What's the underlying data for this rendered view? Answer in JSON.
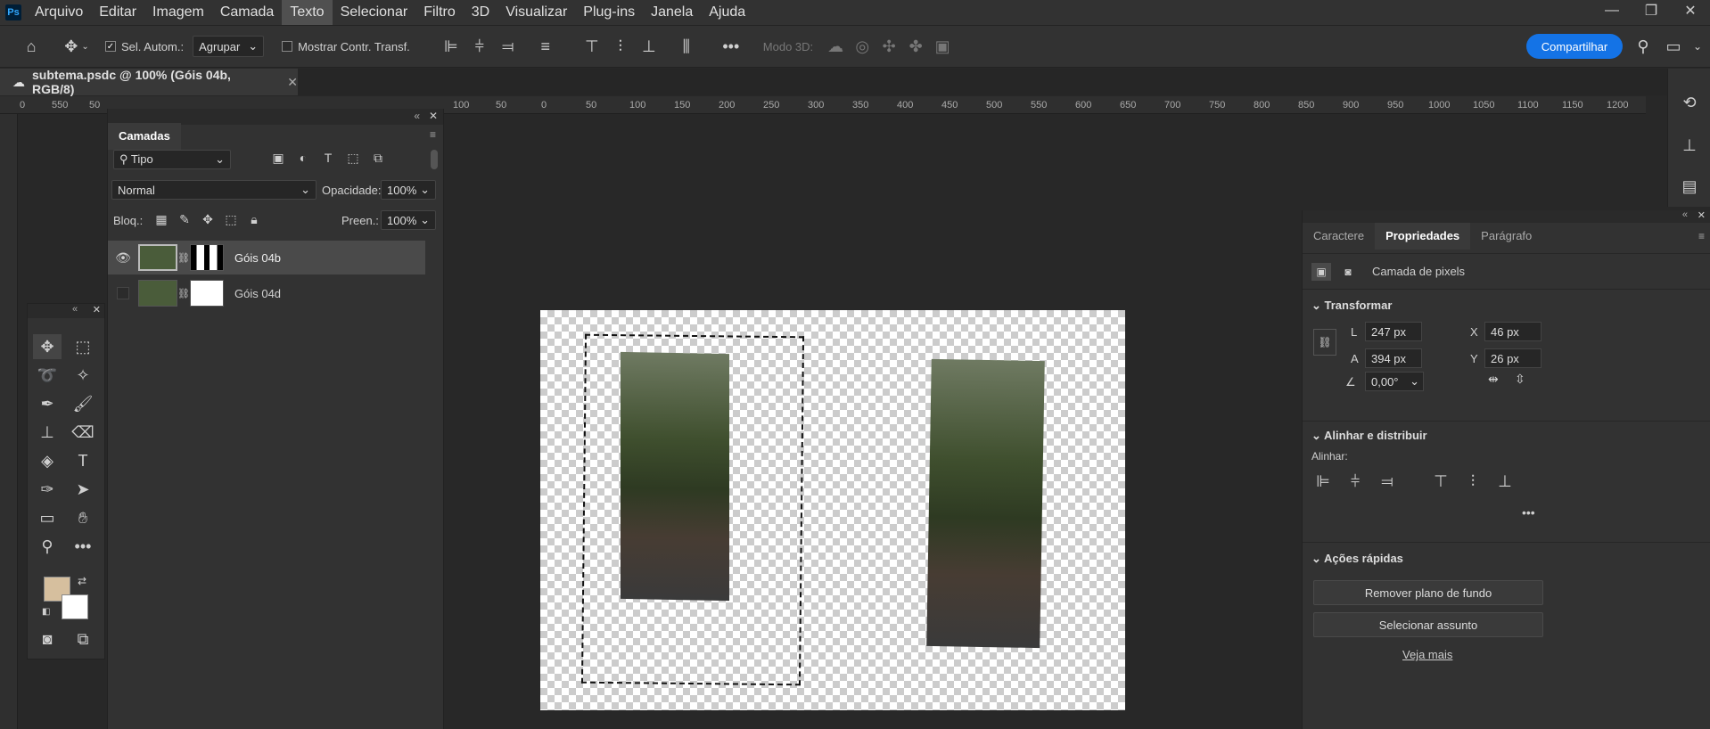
{
  "app": {
    "logo": "Ps"
  },
  "menu": [
    "Arquivo",
    "Editar",
    "Imagem",
    "Camada",
    "Texto",
    "Selecionar",
    "Filtro",
    "3D",
    "Visualizar",
    "Plug-ins",
    "Janela",
    "Ajuda"
  ],
  "options": {
    "auto_select_label": "Sel. Autom.:",
    "group_value": "Agrupar",
    "show_transform_label": "Mostrar Contr. Transf.",
    "mode_3d_label": "Modo 3D:",
    "share_label": "Compartilhar"
  },
  "document": {
    "tab_title": "subtema.psdc @ 100% (Góis 04b, RGB/8)"
  },
  "ruler": {
    "h_ticks": [
      "0",
      "550",
      "50",
      "100",
      "50",
      "0",
      "50",
      "100",
      "150",
      "200",
      "250",
      "300",
      "350",
      "400",
      "450",
      "500",
      "550",
      "600",
      "650",
      "700",
      "750",
      "800",
      "850",
      "900",
      "950",
      "1000",
      "1050",
      "1100",
      "1150",
      "1200"
    ]
  },
  "layers_panel": {
    "tab": "Camadas",
    "filter_value": "Tipo",
    "blend_mode": "Normal",
    "opacity_label": "Opacidade:",
    "opacity_value": "100%",
    "lock_label": "Bloq.:",
    "fill_label": "Preen.:",
    "fill_value": "100%",
    "layers": [
      {
        "name": "Góis 04b",
        "visible": true
      },
      {
        "name": "Góis 04d",
        "visible": false
      }
    ]
  },
  "props_panel": {
    "tabs": [
      "Caractere",
      "Propriedades",
      "Parágrafo"
    ],
    "layer_type": "Camada de pixels",
    "transform": {
      "title": "Transformar",
      "w_label": "L",
      "w_value": "247 px",
      "h_label": "A",
      "h_value": "394 px",
      "x_label": "X",
      "x_value": "46 px",
      "y_label": "Y",
      "y_value": "26 px",
      "angle_value": "0,00°"
    },
    "align": {
      "title": "Alinhar e distribuir",
      "sub": "Alinhar:"
    },
    "quick": {
      "title": "Ações rápidas",
      "remove_bg": "Remover plano de fundo",
      "select_subject": "Selecionar assunto",
      "see_more": "Veja mais"
    }
  },
  "colors": {
    "foreground": "#d6bf9e",
    "background": "#ffffff",
    "accent": "#1473e6"
  }
}
